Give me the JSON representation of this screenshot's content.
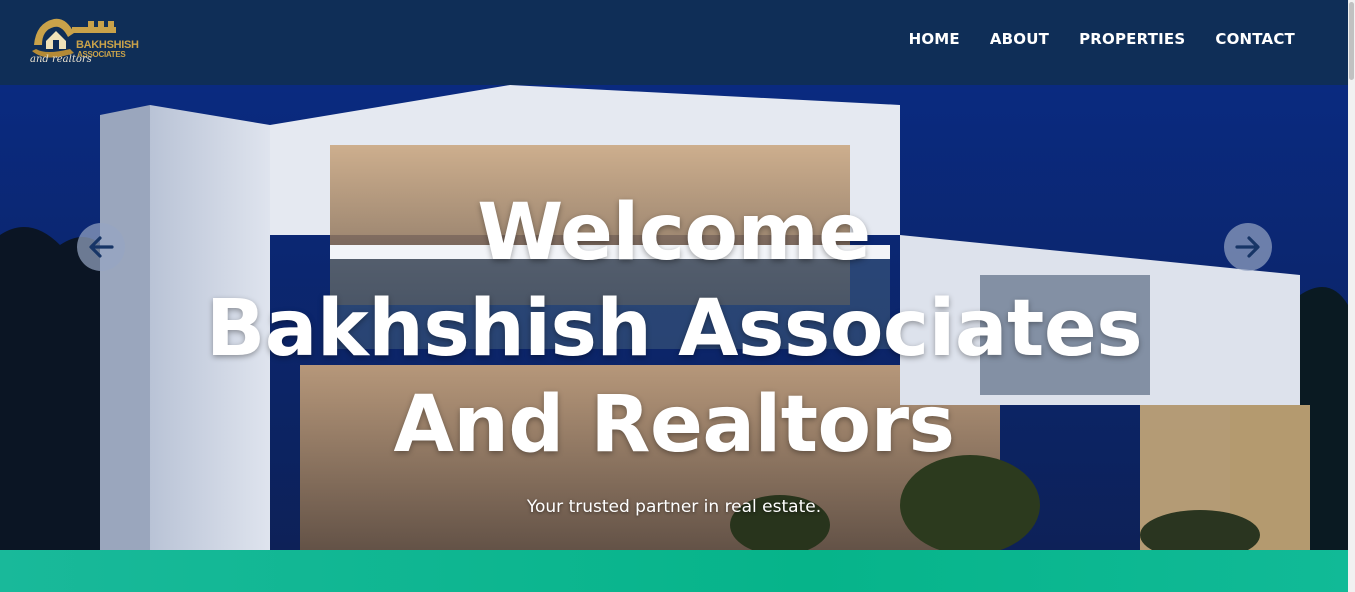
{
  "brand": {
    "line1": "BAKHSHISH",
    "line2": "ASSOCIATES",
    "script": "and realtors",
    "gold": "#c9a24a"
  },
  "nav": {
    "items": [
      "HOME",
      "ABOUT",
      "PROPERTIES",
      "CONTACT"
    ],
    "background": "#0f2e57"
  },
  "hero": {
    "title_lines": [
      "Welcome",
      "Bakhshish Associates",
      "And Realtors"
    ],
    "subtitle": "Your trusted partner in real estate.",
    "prev_icon": "arrow-left-icon",
    "next_icon": "arrow-right-icon"
  },
  "band": {
    "color": "#06b48a"
  }
}
